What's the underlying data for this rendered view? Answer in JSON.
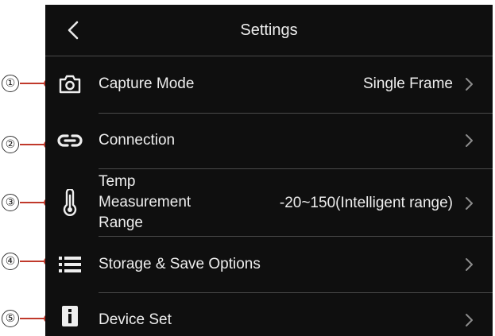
{
  "header": {
    "title": "Settings",
    "back_icon": "chevron-left-icon"
  },
  "callouts": [
    "①",
    "②",
    "③",
    "④",
    "⑤"
  ],
  "accent_color": "#c0392b",
  "items": [
    {
      "label": "Capture Mode",
      "value": "Single Frame",
      "icon": "camera-icon"
    },
    {
      "label": "Connection",
      "value": "",
      "icon": "link-icon"
    },
    {
      "label_lines": [
        "Temp",
        "Measurement",
        "Range"
      ],
      "value": "-20~150(Intelligent range)",
      "icon": "thermometer-icon"
    },
    {
      "label": "Storage & Save Options",
      "value": "",
      "icon": "list-icon"
    },
    {
      "label": "Device Set",
      "value": "",
      "icon": "info-icon"
    }
  ]
}
